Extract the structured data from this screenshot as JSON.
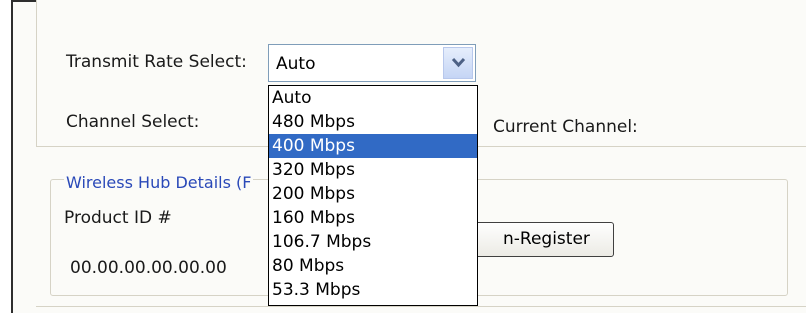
{
  "transmit_rate": {
    "label": "Transmit Rate Select:",
    "selected_value": "Auto",
    "options": [
      "Auto",
      "480 Mbps",
      "400 Mbps",
      "320 Mbps",
      "200 Mbps",
      "160 Mbps",
      "106.7 Mbps",
      "80 Mbps",
      "53.3 Mbps"
    ],
    "highlighted_option": "400 Mbps"
  },
  "channel": {
    "label": "Channel Select:",
    "current_label": "Current Channel:"
  },
  "hub_details": {
    "legend": "Wireless Hub Details (F",
    "product_id_label": "Product ID #",
    "product_id_value": "00.00.00.00.00.00",
    "register_button_label": "n-Register"
  },
  "colors": {
    "highlight": "#316ac5",
    "legend_text": "#2a49b8"
  },
  "icons": {
    "dropdown_arrow": "chevron-down-icon"
  }
}
